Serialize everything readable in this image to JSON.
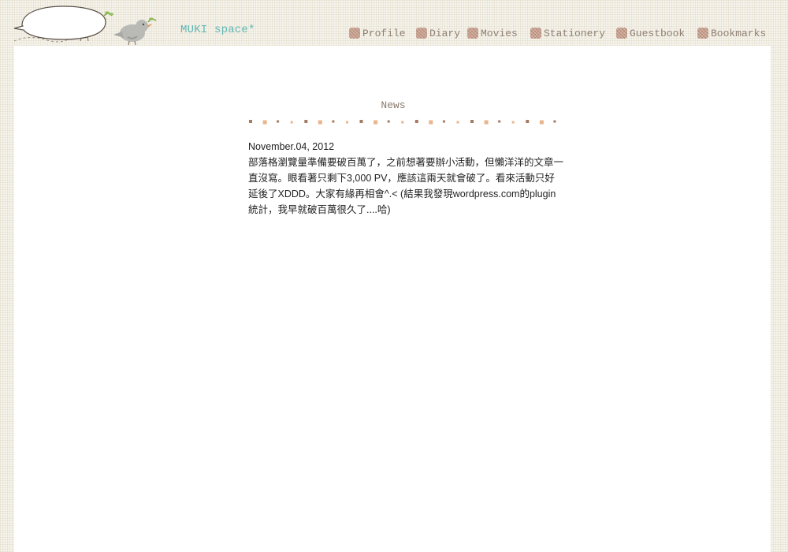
{
  "site": {
    "title": "MUKI space*"
  },
  "nav": {
    "items": [
      {
        "label": "Profile",
        "icon": "checkered-square-icon"
      },
      {
        "label": "Diary",
        "icon": "checkered-square-icon"
      },
      {
        "label": "Movies",
        "icon": "checkered-square-icon"
      },
      {
        "label": "Stationery",
        "icon": "checkered-square-icon"
      },
      {
        "label": "Guestbook",
        "icon": "checkered-square-icon"
      },
      {
        "label": "Bookmarks",
        "icon": "checkered-square-icon"
      }
    ]
  },
  "news": {
    "heading": "News",
    "posts": [
      {
        "date": "November.04, 2012",
        "body": "部落格瀏覽量準備要破百萬了，之前想著要辦小活動，但懶洋洋的文章一直沒寫。眼看著只剩下3,000 PV，應該這兩天就會破了。看來活動只好延後了XDDD。大家有緣再相會^.< (結果我發現wordpress.com的plugin統計，我早就破百萬很久了....哈)"
      }
    ]
  },
  "colors": {
    "title": "#5fb7b5",
    "nav_text": "#8f7f74",
    "nav_icon": "#c59b88",
    "heading": "#8a7a6c",
    "dot_orange": "#e2a270",
    "dot_brown": "#9a6e52"
  }
}
